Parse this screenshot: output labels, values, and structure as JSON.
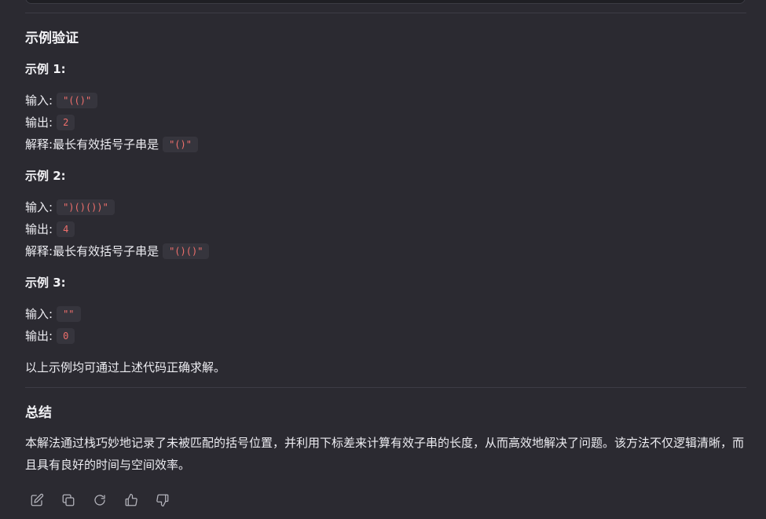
{
  "sections": {
    "verify_title": "示例验证",
    "examples": [
      {
        "title": "示例 1:",
        "input_label": "输入:",
        "input_value": "\"(()\"",
        "output_label": "输出:",
        "output_value": "2",
        "explain_label": "解释:",
        "explain_text": "最长有效括号子串是",
        "explain_code": "\"()\""
      },
      {
        "title": "示例 2:",
        "input_label": "输入:",
        "input_value": "\")()())\"",
        "output_label": "输出:",
        "output_value": "4",
        "explain_label": "解释:",
        "explain_text": "最长有效括号子串是",
        "explain_code": "\"()()\""
      },
      {
        "title": "示例 3:",
        "input_label": "输入:",
        "input_value": "\"\"",
        "output_label": "输出:",
        "output_value": "0"
      }
    ],
    "verify_conclusion": "以上示例均可通过上述代码正确求解。",
    "summary_title": "总结",
    "summary_text": "本解法通过栈巧妙地记录了未被匹配的括号位置，并利用下标差来计算有效子串的长度，从而高效地解决了问题。该方法不仅逻辑清晰，而且具有良好的时间与空间效率。"
  },
  "actions": [
    {
      "icon": "edit-icon"
    },
    {
      "icon": "copy-icon"
    },
    {
      "icon": "regenerate-icon"
    },
    {
      "icon": "thumbs-up-icon"
    },
    {
      "icon": "thumbs-down-icon"
    }
  ]
}
